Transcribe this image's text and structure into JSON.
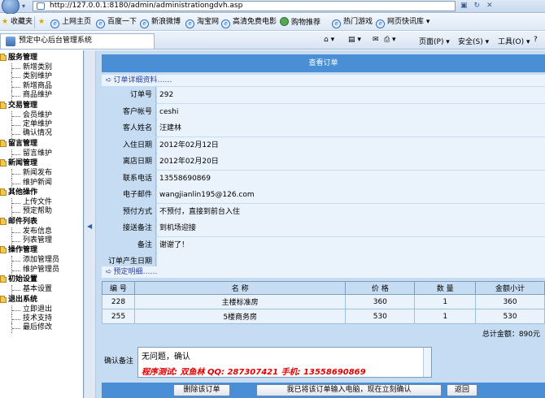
{
  "browser": {
    "url": "http://127.0.0.1:8180/admin/administrationgdvh.asp",
    "favorites_label": "收藏夹",
    "favorites": [
      "上网主页",
      "百度一下",
      "新浪微博",
      "淘宝网",
      "高清免费电影",
      "购物推荐",
      "热门游戏",
      "网页快讯库 ▾"
    ],
    "tab_title": "预定中心后台管理系统",
    "tools": [
      "页面(P) ▾",
      "安全(S) ▾",
      "工具(O) ▾",
      "?"
    ]
  },
  "sidebar": {
    "groups": [
      {
        "title": "服务管理",
        "items": [
          "新增类别",
          "类别维护",
          "新增商品",
          "商品维护"
        ]
      },
      {
        "title": "交易管理",
        "items": [
          "会员维护",
          "定单维护",
          "确认情况"
        ]
      },
      {
        "title": "留言管理",
        "items": [
          "留言维护"
        ]
      },
      {
        "title": "新闻管理",
        "items": [
          "新闻发布",
          "维护新闻"
        ]
      },
      {
        "title": "其他操作",
        "items": [
          "上传文件",
          "预定帮助"
        ]
      },
      {
        "title": "邮件列表",
        "items": [
          "发布信息",
          "列表管理"
        ]
      },
      {
        "title": "操作管理",
        "items": [
          "添加管理员",
          "维护管理员"
        ]
      },
      {
        "title": "初始设置",
        "items": [
          "基本设置"
        ]
      },
      {
        "title": "退出系统",
        "items": [
          "立即退出",
          "技术支持",
          "最后修改"
        ]
      }
    ]
  },
  "main": {
    "title": "查看订单",
    "detail_header": "订单详细资料……",
    "fields": [
      {
        "label": "订单号",
        "value": "292"
      },
      {
        "label": "客户帐号",
        "value": "ceshi"
      },
      {
        "label": "客人姓名",
        "value": "汪建林"
      },
      {
        "label": "入住日期",
        "value": "2012年02月12日"
      },
      {
        "label": "离店日期",
        "value": "2012年02月20日"
      },
      {
        "label": "联系电话",
        "value": "13558690869"
      },
      {
        "label": "电子邮件",
        "value": "wangjianlin195@126.com"
      },
      {
        "label": "预付方式",
        "value": "不预付，直接到前台入住"
      },
      {
        "label": "接送备注",
        "value": "到机场迎接"
      },
      {
        "label": "备注",
        "value": "谢谢了！"
      },
      {
        "label": "订单产生日期",
        "value": ""
      }
    ],
    "items_header": "预定明细……",
    "table": {
      "headers": [
        "编 号",
        "名 称",
        "价 格",
        "数 量",
        "金额小计"
      ],
      "rows": [
        [
          "228",
          "主楼标准房",
          "360",
          "1",
          "360"
        ],
        [
          "255",
          "5楼商务房",
          "530",
          "1",
          "530"
        ]
      ]
    },
    "total": "总计金额：890元",
    "note_label": "确认备注",
    "note_text": "无问题，确认",
    "note_signature": "程序测试: 双鱼林   QQ: 287307421   手机: 13558690869",
    "buttons": {
      "delete": "删除该订单",
      "confirm": "我已将该订单输入电脑，现在立刻确认",
      "back": "返回"
    }
  }
}
